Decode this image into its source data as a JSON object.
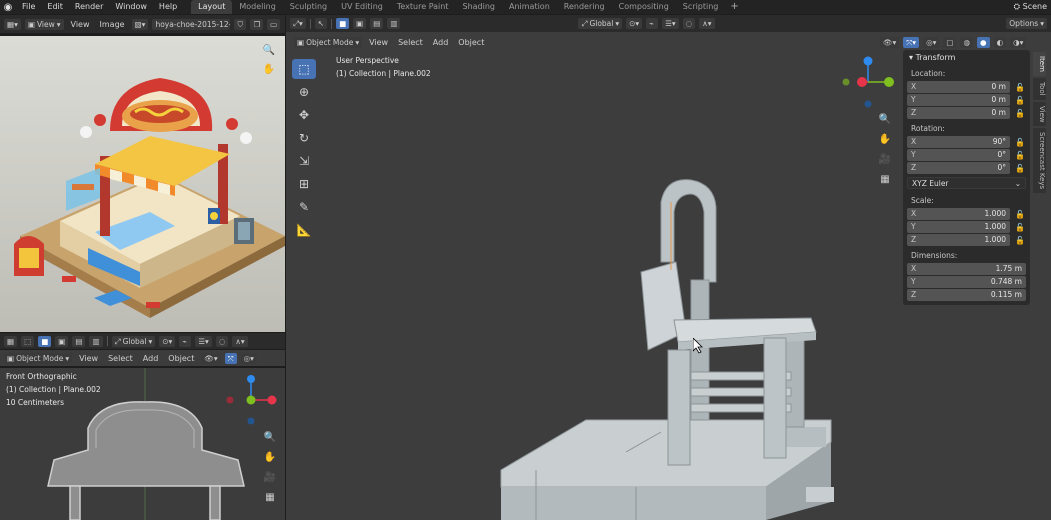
{
  "topbar": {
    "menus": [
      "File",
      "Edit",
      "Render",
      "Window",
      "Help"
    ],
    "workspaces": [
      "Layout",
      "Modeling",
      "Sculpting",
      "UV Editing",
      "Texture Paint",
      "Shading",
      "Animation",
      "Rendering",
      "Compositing",
      "Scripting"
    ],
    "active_workspace": "Layout",
    "add_tab": "+",
    "scene_label": "Scene"
  },
  "image_editor": {
    "menus": [
      "View",
      "View",
      "Image"
    ],
    "image_name": "hoya-choe-2015-12-..."
  },
  "front_viewport": {
    "mode": "Object Mode",
    "menus": [
      "View",
      "Select",
      "Add",
      "Object"
    ],
    "orientation": "Global",
    "info_lines": [
      "Front Orthographic",
      "(1) Collection | Plane.002",
      "10 Centimeters"
    ]
  },
  "main_viewport": {
    "mode": "Object Mode",
    "menus": [
      "View",
      "Select",
      "Add",
      "Object"
    ],
    "orientation": "Global",
    "options_label": "Options",
    "info_lines": [
      "User Perspective",
      "(1) Collection | Plane.002"
    ]
  },
  "transform_panel": {
    "title": "Transform",
    "location_label": "Location:",
    "location": [
      {
        "axis": "X",
        "value": "0 m"
      },
      {
        "axis": "Y",
        "value": "0 m"
      },
      {
        "axis": "Z",
        "value": "0 m"
      }
    ],
    "rotation_label": "Rotation:",
    "rotation": [
      {
        "axis": "X",
        "value": "90°"
      },
      {
        "axis": "Y",
        "value": "0°"
      },
      {
        "axis": "Z",
        "value": "0°"
      }
    ],
    "rotation_mode": "XYZ Euler",
    "scale_label": "Scale:",
    "scale": [
      {
        "axis": "X",
        "value": "1.000"
      },
      {
        "axis": "Y",
        "value": "1.000"
      },
      {
        "axis": "Z",
        "value": "1.000"
      }
    ],
    "dimensions_label": "Dimensions:",
    "dimensions": [
      {
        "axis": "X",
        "value": "1.75 m"
      },
      {
        "axis": "Y",
        "value": "0.748 m"
      },
      {
        "axis": "Z",
        "value": "0.115 m"
      }
    ]
  },
  "side_tabs": [
    "Item",
    "Tool",
    "View",
    "Screencast Keys"
  ],
  "colors": {
    "accent": "#4772b3",
    "gizmo_x": "#e6344b",
    "gizmo_y": "#7fbf1f",
    "gizmo_z": "#2e8bf0"
  }
}
